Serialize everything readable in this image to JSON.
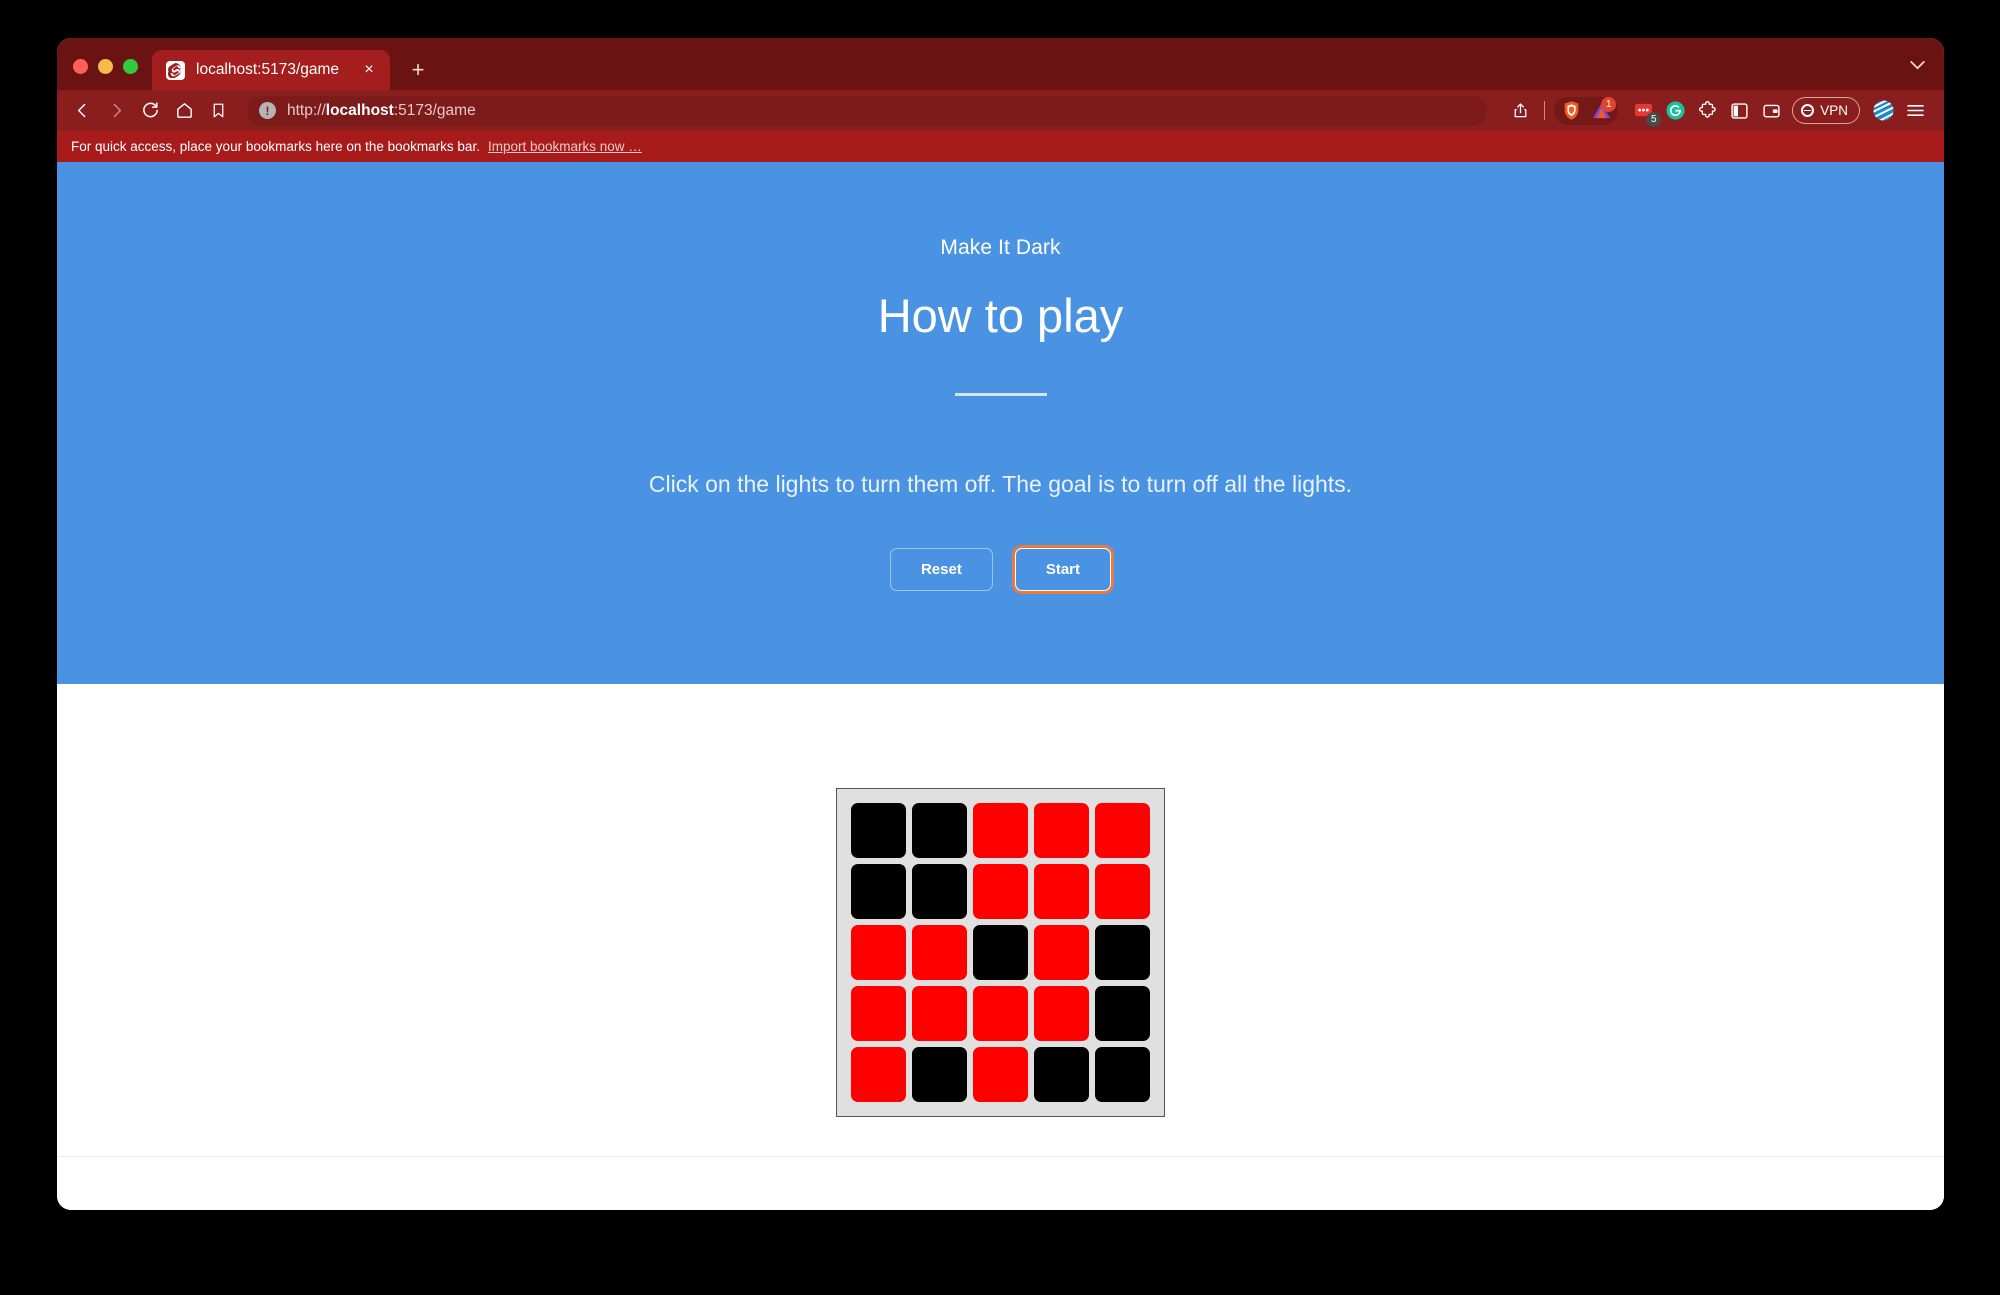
{
  "window": {
    "traffic_lights": [
      "close",
      "minimize",
      "maximize"
    ]
  },
  "tab_strip": {
    "active_tab": {
      "title": "localhost:5173/game",
      "favicon": "svelte-logo-icon",
      "close_label": "×"
    },
    "new_tab_label": "+",
    "tab_list_icon": "chevron-down-icon"
  },
  "toolbar": {
    "back_icon": "back-arrow-icon",
    "forward_icon": "forward-arrow-icon",
    "reload_icon": "reload-icon",
    "home_icon": "home-icon",
    "bookmark_icon": "bookmark-icon",
    "site_info_icon": "info-icon",
    "site_info_glyph": "!",
    "url_scheme": "http://",
    "url_host": "localhost",
    "url_rest": ":5173/game",
    "url_full": "http://localhost:5173/game",
    "right_icons": [
      {
        "name": "share-icon",
        "label": ""
      },
      {
        "name": "brave-shield-icon",
        "label": ""
      },
      {
        "name": "brave-rewards-icon",
        "label": "",
        "badge": "1",
        "badge_color": "#e0452c"
      },
      {
        "name": "extension-red-icon",
        "label": "",
        "badge": "5",
        "badge_color": "#4a4a4a"
      },
      {
        "name": "grammarly-icon",
        "label": "G"
      },
      {
        "name": "extensions-puzzle-icon",
        "label": ""
      },
      {
        "name": "sidebar-panel-icon",
        "label": ""
      },
      {
        "name": "wallet-icon",
        "label": ""
      }
    ],
    "vpn_label": "VPN",
    "profile_icon": "profile-globe-icon",
    "menu_icon": "hamburger-menu-icon"
  },
  "bookmarks_bar": {
    "message": "For quick access, place your bookmarks here on the bookmarks bar.",
    "import_link": "Import bookmarks now …"
  },
  "page": {
    "hero": {
      "eyebrow": "Make It Dark",
      "title": "How to play",
      "instructions": "Click on the lights to turn them off. The goal is to turn off all the lights.",
      "reset_label": "Reset",
      "start_label": "Start",
      "background_color": "#4a93e2"
    },
    "board": {
      "rows": 5,
      "columns": 5,
      "on_color": "#ff0000",
      "off_color": "#000000",
      "frame_color": "#e0e0e0",
      "grid": [
        [
          0,
          0,
          1,
          1,
          1
        ],
        [
          0,
          0,
          1,
          1,
          1
        ],
        [
          1,
          1,
          0,
          1,
          0
        ],
        [
          1,
          1,
          1,
          1,
          0
        ],
        [
          1,
          0,
          1,
          0,
          0
        ]
      ]
    }
  }
}
